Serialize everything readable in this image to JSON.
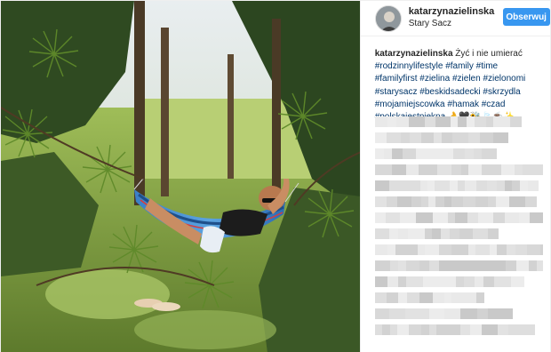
{
  "header": {
    "username": "katarzynazielinska",
    "location": "Stary Sacz",
    "follow_label": "Obserwuj"
  },
  "caption": {
    "username": "katarzynazielinska",
    "text": "Żyć i nie umierać",
    "hashtags": [
      "#rodzinnylifestyle",
      "#family",
      "#time",
      "#familyfirst",
      "#zielina",
      "#zielen",
      "#zielonomi",
      "#starysacz",
      "#beskidsadecki",
      "#skrzydla",
      "#mojamiejscowka",
      "#hamak",
      "#czad",
      "#polskajestpiekna"
    ],
    "emoji": "👌🖤🐝🍃☕✨"
  },
  "colors": {
    "accent": "#3897f0",
    "hashtag": "#003569",
    "pixelated_comments": "#e4e4e4"
  }
}
